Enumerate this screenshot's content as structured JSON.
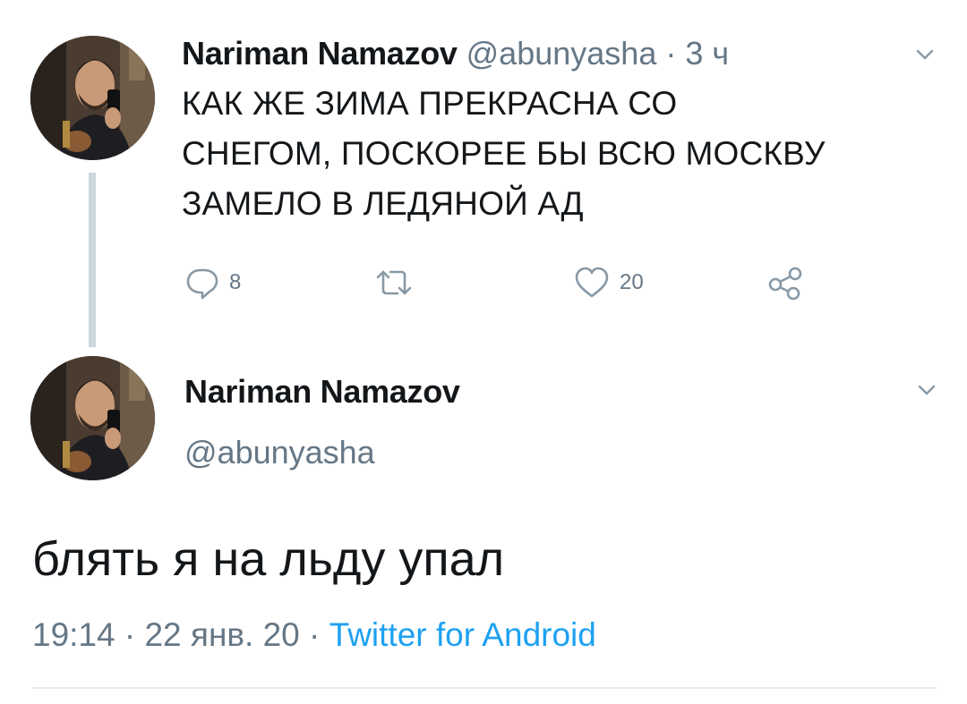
{
  "colors": {
    "text": "#14171a",
    "muted": "#657786",
    "link": "#1da1f2",
    "thread_line": "#ccd6dd"
  },
  "tweet1": {
    "author_name": "Nariman Namazov",
    "handle": "@abunyasha",
    "separator": "·",
    "time": "3 ч",
    "text_lines": [
      "КАК ЖЕ ЗИМА ПРЕКРАСНА СО",
      "СНЕГОМ, ПОСКОРЕЕ БЫ ВСЮ МОСКВУ",
      "ЗАМЕЛО В ЛЕДЯНОЙ АД"
    ],
    "actions": {
      "reply_icon": "reply-icon",
      "reply_count": "8",
      "retweet_icon": "retweet-icon",
      "like_icon": "heart-icon",
      "like_count": "20",
      "share_icon": "share-icon"
    }
  },
  "tweet2": {
    "author_name": "Nariman Namazov",
    "handle": "@abunyasha",
    "text": "блять я на льду упал",
    "time": "19:14",
    "separator1": "·",
    "date": "22 янв. 20",
    "separator2": "·",
    "source": "Twitter for Android"
  }
}
